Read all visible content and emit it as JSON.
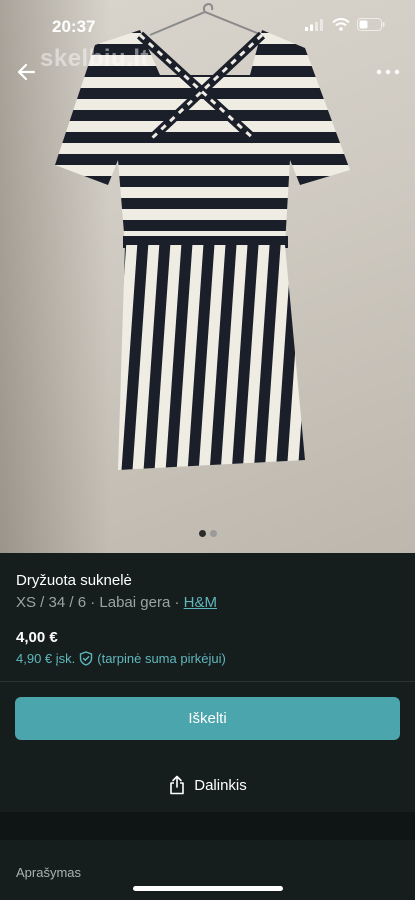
{
  "status_bar": {
    "time": "20:37"
  },
  "watermark": "skelbiu.lt",
  "gallery": {
    "total_images": 2,
    "active_index": 0
  },
  "listing": {
    "title": "Dryžuota suknelė",
    "size": "XS / 34 / 6",
    "separator": " · ",
    "condition": "Labai gera",
    "brand": "H&M",
    "price": "4,00 €",
    "price_incl": "4,90 € įsk.",
    "price_note": "(tarpinė suma pirkėjui)"
  },
  "actions": {
    "buy_label": "Iškelti",
    "share_label": "Dalinkis"
  },
  "description": {
    "label": "Aprašymas"
  },
  "colors": {
    "background": "#161e1d",
    "accent": "#4aa5ac",
    "link": "#5fb7bd"
  },
  "icons": [
    "back-arrow-icon",
    "more-icon",
    "signal-icon",
    "wifi-icon",
    "battery-icon",
    "shield-check-icon",
    "share-icon"
  ]
}
